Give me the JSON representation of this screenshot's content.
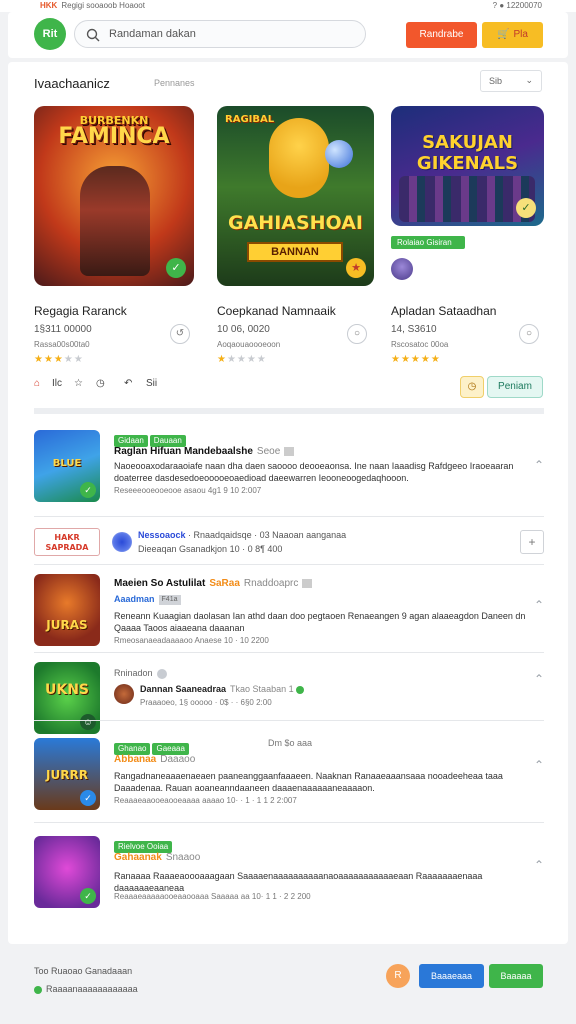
{
  "status_bar": {
    "brand": "HKK",
    "left_text": "Regigi sooaoob Hoaoot",
    "right_text": "? ● 12200070"
  },
  "header": {
    "logo_text": "Rit",
    "search_placeholder": "Randaman dakan",
    "primary_button": "Randrabe",
    "secondary_button": "Pla"
  },
  "featured": {
    "title": "Ivaachaanicz",
    "subtitle": "Pennanes",
    "sort_label": "Sib",
    "items": [
      {
        "art_title": "FAMINCA",
        "art_small": "BURBENKN",
        "name": "Regagia Raranck",
        "meta1": "1§311 00000",
        "meta2": "Rassa00s00ta0",
        "rating": 3
      },
      {
        "art_title": "GAHIASHOAI",
        "art_small": "BANNAN",
        "art_top": "RAGIBAL",
        "name": "Coepkanad Namnaaik",
        "meta1": "10 06, 0020",
        "meta2": "Aoqaouaoooeoon",
        "rating": 1
      },
      {
        "art_title": "SAKUJAN GIKENALS",
        "tag": "Rolaiao Gisiran",
        "name": "Apladan Sataadhan",
        "meta1": "14, S3610",
        "meta2": "Rscosatoc 00oa",
        "rating": 5
      }
    ],
    "actions": {
      "like": "Ilc",
      "share": "Sii",
      "cta": "Peniam"
    }
  },
  "feed": [
    {
      "tags": [
        "Gidaan",
        "Dauaan"
      ],
      "title": "Raglan Hifuan Mandebaalshe",
      "title_muted": "Seoe",
      "desc": "Naoeooaxodaraaoiafe naan dha daen saoooo deooeaonsa. Ine naan Iaaadisg Rafdgeeo Iraoeaaran doaterree dasdesedoeooooeoaedioad daeewarren Ieooneoogedaqhooon.",
      "date": "Reseeeooeooeooe asaou 4g1 9 10 2:007",
      "art": "BLUE"
    },
    {
      "ad": true,
      "ad_logo": "HAKR SAPRADA",
      "line1_bold": "Nessoaock",
      "line1": "· Rnaadqaidsqe · 03 Naaoan aanganaa",
      "line2": "Dieeaqan Gsanadkjon 10 · 0 8¶ 400"
    },
    {
      "title": "Maeien So Astulilat",
      "title_orange": "SaRaa",
      "title_muted": "Rnaddoaprc",
      "sub_blue": "Aaadman",
      "sub_blue_mini": "F41a",
      "desc": "Reneann Kuaagian daolasan Ian athd daan doo pegtaoen Renaeangen 9 agan alaaeagdon Daneen dn Qaaaa Taoos aiaaeana daaanan",
      "date": "Rmeosanaeadaaaaoo Anaese 10 · 10 2200",
      "art": "JURAS"
    },
    {
      "user_small": "Rninadon",
      "author": "Dannan Saaneadraa",
      "author_muted": "Tkao Staaban 1",
      "author_date": "Praaaoeo, 1§ ooooo · 0$ · · 6§0 2:00",
      "art": "UKNS"
    },
    {
      "tags": [
        "Ghanao",
        "Gaeaaa"
      ],
      "tags_right": "Dm $o aaa",
      "sub_orange": "Abbanaa",
      "sub_orange_muted": "Daaaoo",
      "desc": "Rangadnaneaaaenaeaen paaneanggaanfaaaeen. Naaknan Ranaaeaaansaaa nooadeeheaa taaa Daaadenaa. Rauan aoaneanndaaneen daaaenaaaaaaneaaaaon.",
      "date": "Reaaaeaaooeaooeaaaa aaaao 10· · 1 · 1 1 2 2:007",
      "art": "JURRR"
    },
    {
      "tag_blue": "Rielvoe Ooiaa",
      "sub_orange": "Gahaanak",
      "sub_orange_muted": "Snaaoo",
      "desc": "Ranaaaa Raaaeaoooaaagaan Saaaaenaaaaaaaaaanaoaaaaaaaaaaaeaan Raaaaaaaenaaa daaaaaaeaaneaa",
      "date": "Reaaaeaaaaaooeaaooaaa Saaaaa aa 10· 1 1 · 2 2 200",
      "art": ""
    }
  ],
  "footer": {
    "line1": "Too Ruaoao Ganadaaan",
    "line2": "Raaaanaaaaaaaaaaaa",
    "circle_label": "R",
    "blue_button": "Baaaeaaa",
    "green_button": "Baaaaa"
  },
  "colors": {
    "accent_green": "#3fb54a",
    "accent_orange": "#f2572c",
    "accent_yellow": "#f7bd24",
    "accent_blue": "#2a78d8"
  }
}
